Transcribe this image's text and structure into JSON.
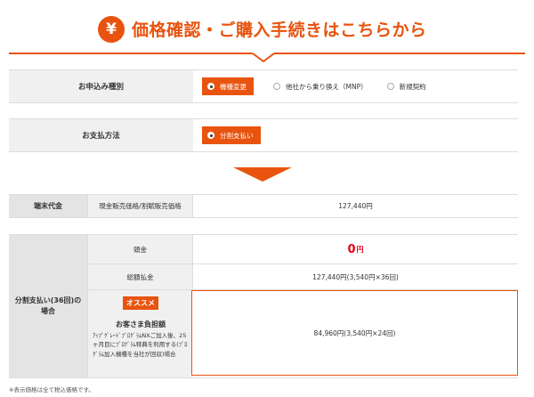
{
  "header": {
    "icon_glyph": "¥",
    "title": "価格確認・ご購入手続きはこちらから"
  },
  "application_type": {
    "label": "お申込み種別",
    "options": [
      {
        "label": "機種変更",
        "selected": true
      },
      {
        "label": "他社から乗り換え（MNP）",
        "selected": false
      },
      {
        "label": "新規契約",
        "selected": false
      }
    ]
  },
  "payment_method": {
    "label": "お支払方法",
    "options": [
      {
        "label": "分割支払い",
        "selected": true
      }
    ]
  },
  "device_price": {
    "label": "端末代金",
    "sub_label": "現金販売価格/割賦販売価格",
    "value": "127,440円"
  },
  "installment": {
    "label": "分割支払い(36回)の場合",
    "down_payment_label": "頭金",
    "down_payment_value": "0",
    "down_payment_unit": "円",
    "total_label": "総額払金",
    "total_value": "127,440円(3,540円×36回)",
    "recommend_badge": "オススメ",
    "recommend_title": "お客さま負担額",
    "recommend_desc": "ｱｯﾌﾟｸﾞﾚｰﾄﾞﾌﾟﾛｸﾞﾗﾑNXご加入後、25ヶ月目にﾌﾟﾛｸﾞﾗﾑ特典を利用する(ﾌﾟﾛｸﾞﾗﾑ加入機種を当社が回収)場合",
    "recommend_value": "84,960円(3,540円×24回)"
  },
  "footnote": "※表示価格は全て税込価格です。",
  "colors": {
    "accent": "#e8540f",
    "highlight_red": "#e60012"
  }
}
